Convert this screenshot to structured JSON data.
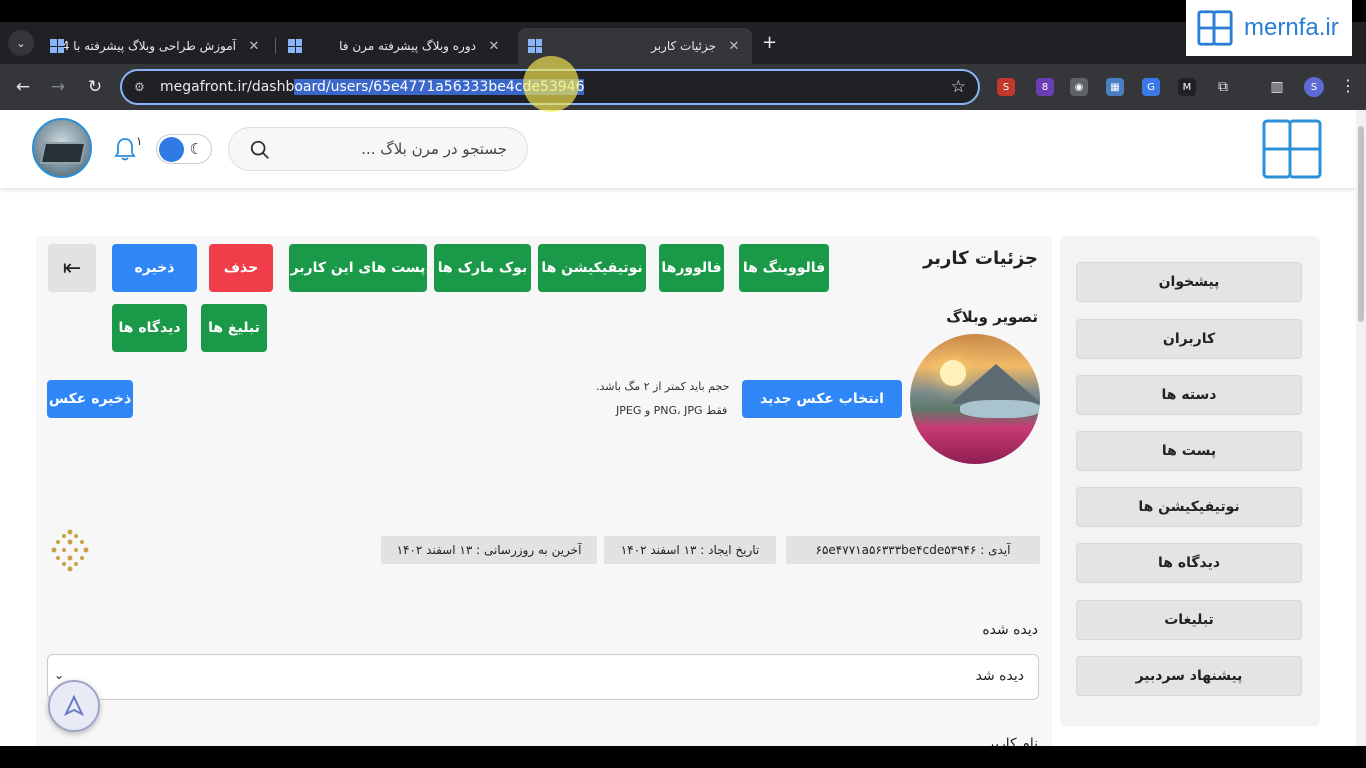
{
  "browser": {
    "tabs": [
      {
        "title": "آموزش طراحی وبلاگ پیشرفته با 4"
      },
      {
        "title": "دوره وبلاگ پیشرفته مرن فا"
      },
      {
        "title": "جزئیات کاربر"
      }
    ],
    "url_prefix": "megafront.ir/dashb",
    "url_selected": "oard/users/65e4771a56333be4cde53946",
    "new_tab": "+",
    "profile_initial": "S"
  },
  "watermark": {
    "brand": "mernfa",
    "tld": ".ir"
  },
  "header": {
    "search_placeholder": "جستجو در مرن بلاگ ...",
    "notification_count": "۱"
  },
  "sidebar": {
    "items": [
      {
        "label": "پیشخوان"
      },
      {
        "label": "کاربران"
      },
      {
        "label": "دسته ها"
      },
      {
        "label": "پست ها"
      },
      {
        "label": "نوتیفیکیشن ها"
      },
      {
        "label": "دیدگاه ها"
      },
      {
        "label": "تبلیغات"
      },
      {
        "label": "پیشنهاد سردبیر"
      }
    ]
  },
  "main": {
    "title": "جزئیات کاربر",
    "buttons": {
      "following": "فالووینگ ها",
      "followers": "فالوورها",
      "notifications": "نوتیفیکیشن ها",
      "bookmarks": "بوک مارک ها",
      "user_posts": "پست های این کاربر",
      "delete": "حذف",
      "save": "ذخیره",
      "ads": "تبلیغ ها",
      "comments": "دیدگاه ها",
      "choose_image": "انتخاب عکس جدید",
      "save_image": "ذخیره عکس"
    },
    "blog_image_label": "تصویر وبلاگ",
    "size_hint": "حجم باید کمتر از ۲ مگ باشد.",
    "format_hint": "فقط PNG، JPG و JPEG",
    "id_text": "آیدی : ۶۵e۴۷۷۱a۵۶۳۳۳be۴cde۵۳۹۴۶",
    "created_text": "تاریخ ایجاد : ۱۳ اسفند ۱۴۰۲",
    "updated_text": "آخرین به روزرسانی : ۱۳ اسفند ۱۴۰۲",
    "seen_label": "دیده شده",
    "seen_value": "دیده شد",
    "username_label": "نام کاربر"
  },
  "colors": {
    "green": "#1a9a48",
    "blue": "#2f86f6",
    "red": "#ef3e4a",
    "brand_blue": "#2a7fd4"
  }
}
